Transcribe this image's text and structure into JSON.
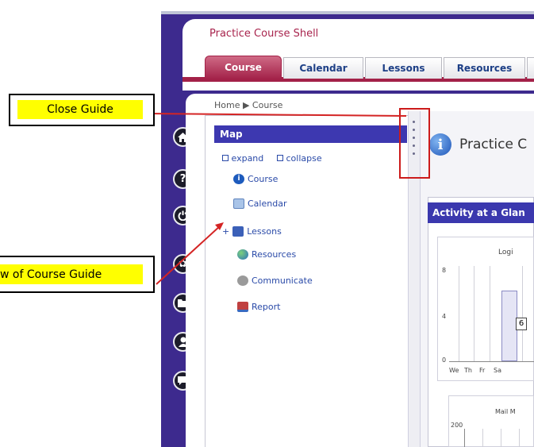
{
  "app": {
    "course_title": "Practice Course Shell",
    "tabs": [
      {
        "label": "Course"
      },
      {
        "label": "Calendar"
      },
      {
        "label": "Lessons"
      },
      {
        "label": "Resources"
      }
    ],
    "breadcrumb": "Home ▶ Course"
  },
  "side_icons": [
    "home-icon",
    "help-icon",
    "power-icon",
    "gear-icon",
    "folder-icon",
    "person-icon",
    "chat-icon"
  ],
  "guide": {
    "header": "Map",
    "expand_label": "expand",
    "collapse_label": "collapse",
    "items": [
      {
        "label": "Course",
        "icon": "info-icon"
      },
      {
        "label": "Calendar",
        "icon": "calendar-icon"
      },
      {
        "label": "Lessons",
        "icon": "lessons-icon",
        "expander": "+"
      },
      {
        "label": "Resources",
        "icon": "globe-icon"
      },
      {
        "label": "Communicate",
        "icon": "communicate-icon"
      },
      {
        "label": "Report",
        "icon": "report-icon"
      }
    ]
  },
  "main": {
    "heading": "Practice C",
    "activity_title": "Activity at a Glan",
    "chart1_title": "Logi",
    "chart2_title": "Mail M",
    "chart2_ytick": "200"
  },
  "chart_data": [
    {
      "type": "bar",
      "title": "Logi",
      "categories": [
        "We",
        "Th",
        "Fr",
        "Sa"
      ],
      "values": [
        0,
        0,
        6,
        0
      ],
      "yticks": [
        "8",
        "4",
        "0"
      ],
      "ylim": [
        0,
        8
      ],
      "data_label": "6",
      "grid": true
    },
    {
      "type": "bar",
      "title": "Mail M",
      "yticks": [
        "200"
      ]
    }
  ],
  "annotations": {
    "close_guide": "Close Guide",
    "overview": "w of Course Guide",
    "colors": {
      "callout_bg": "#ffff00",
      "highlight": "#cc1b1b",
      "arrow": "#d42424"
    }
  },
  "colors": {
    "frame": "#3d2a8e",
    "accent": "#a32148",
    "guide_header": "#3d38b0",
    "link": "#2a4aa8"
  }
}
